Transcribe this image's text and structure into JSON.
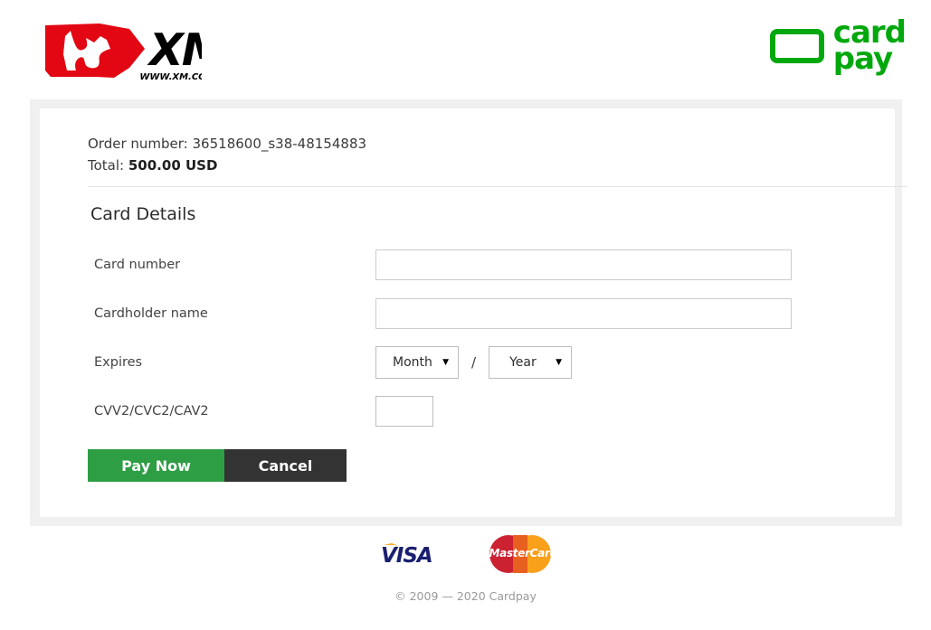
{
  "header": {
    "merchant_logo": {
      "icon": "xm-bull-logo",
      "wordmark": "XM",
      "tagline": "WWW.XM.COM"
    },
    "processor_logo": {
      "icon": "cardpay-card-outline-icon",
      "line1": "card",
      "line2": "pay",
      "color": "#00a80d"
    }
  },
  "order": {
    "order_number_label": "Order number:",
    "order_number_value": "36518600_s38-48154883",
    "total_label": "Total:",
    "total_value": "500.00 USD"
  },
  "form": {
    "section_title": "Card Details",
    "rows": [
      {
        "label": "Card number",
        "field": "card-number",
        "value": "",
        "placeholder": ""
      },
      {
        "label": "Cardholder name",
        "field": "cardholder-name",
        "value": "",
        "placeholder": ""
      },
      {
        "label": "Expires",
        "field": "expiry",
        "month_selected": "Month",
        "year_selected": "Year",
        "separator": "/"
      },
      {
        "label": "CVV2/CVC2/CAV2",
        "field": "cvv",
        "value": "",
        "placeholder": ""
      }
    ]
  },
  "buttons": {
    "pay_label": "Pay Now",
    "pay_color": "#2e9e45",
    "cancel_label": "Cancel",
    "cancel_color": "#333333"
  },
  "footer": {
    "brands": [
      {
        "name": "visa",
        "text": "VISA",
        "color": "#1a1f71"
      },
      {
        "name": "mastercard",
        "text": "MasterCard",
        "color_left": "#cc2131",
        "color_right": "#f9a01b"
      }
    ],
    "copyright": "© 2009 — 2020 Cardpay"
  }
}
